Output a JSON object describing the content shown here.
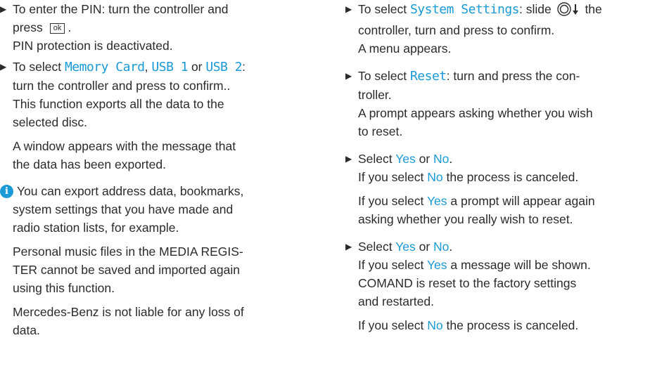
{
  "left": {
    "step1": {
      "line1": "To enter the PIN: turn the controller and",
      "line2_pre": "press",
      "kbd": "ok",
      "line2_post": ".",
      "result": "PIN protection is deactivated."
    },
    "step2": {
      "pre": "To select ",
      "opt1": "Memory Card",
      "sep1": ", ",
      "opt2": "USB 1",
      "sep2": " or ",
      "opt3": "USB 2",
      "post1": ":",
      "line2": "turn the controller and press to confirm..",
      "line3": "This function exports all the data to the",
      "line4": "selected disc.",
      "para2_l1": "A window appears with the message that",
      "para2_l2": "the data has been exported."
    },
    "info": {
      "icon_name": "info-icon",
      "p1_l1": "You can export address data, bookmarks,",
      "p1_l2": "system settings that you have made and",
      "p1_l3": "radio station lists, for example.",
      "p2_l1": "Personal music files in the MEDIA REGIS-",
      "p2_l2": "TER cannot be saved and imported again",
      "p2_l3": "using this function.",
      "p3_l1": "Mercedes-Benz is not liable for any loss of",
      "p3_l2": "data."
    }
  },
  "right": {
    "step1": {
      "pre": "To select ",
      "opt": "System Settings",
      "mid": ": slide ",
      "post": " the",
      "line2": "controller, turn and press to confirm.",
      "line3": "A menu appears."
    },
    "step2": {
      "pre": "To select ",
      "opt": "Reset",
      "post": ": turn and press the con-",
      "line2": "troller.",
      "line3": "A prompt appears asking whether you wish",
      "line4": "to reset."
    },
    "step3": {
      "pre": "Select ",
      "yes": "Yes",
      "or": " or ",
      "no": "No",
      "end": ".",
      "l2_pre": "If you select ",
      "l2_no": "No",
      "l2_post": " the process is canceled.",
      "l3_pre": "If you select ",
      "l3_yes": "Yes",
      "l3_post": " a prompt will appear again",
      "l4": "asking whether you really wish to reset."
    },
    "step4": {
      "pre": "Select ",
      "yes": "Yes",
      "or": " or ",
      "no": "No",
      "end": ".",
      "l2_pre": "If you select ",
      "l2_yes": "Yes",
      "l2_post": " a message will be shown.",
      "l3": "COMAND is reset to the factory settings",
      "l4": "and restarted.",
      "l5_pre": "If you select ",
      "l5_no": "No",
      "l5_post": " the process is canceled."
    }
  }
}
